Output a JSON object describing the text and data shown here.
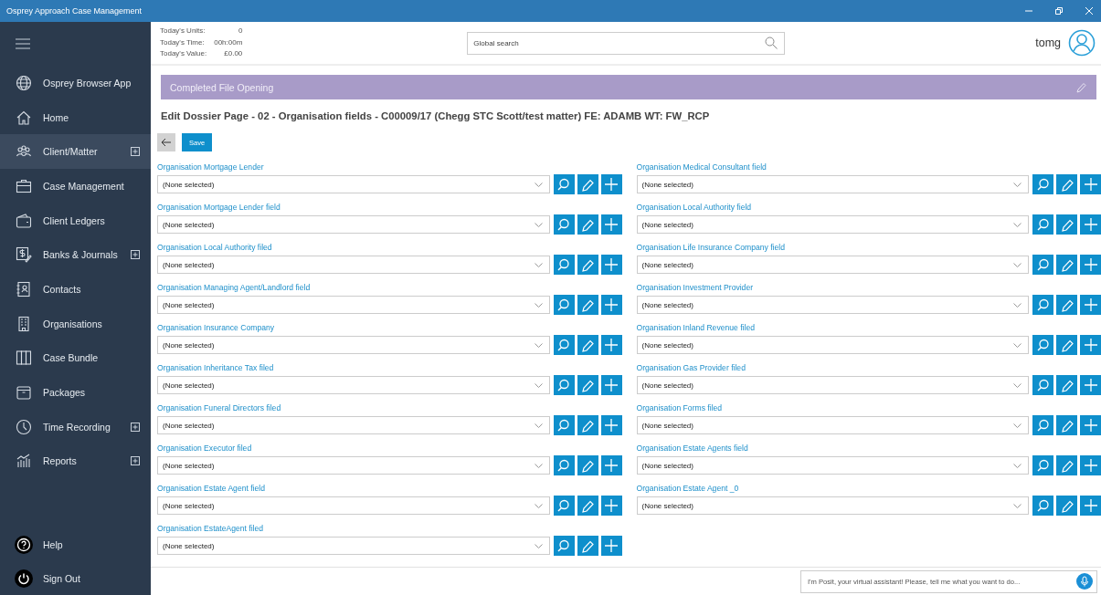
{
  "window": {
    "title": "Osprey Approach Case Management"
  },
  "sidebar": {
    "items": [
      {
        "label": "Osprey Browser App",
        "expandable": false,
        "selected": false
      },
      {
        "label": "Home",
        "expandable": false,
        "selected": false
      },
      {
        "label": "Client/Matter",
        "expandable": true,
        "selected": true
      },
      {
        "label": "Case Management",
        "expandable": false,
        "selected": false
      },
      {
        "label": "Client Ledgers",
        "expandable": false,
        "selected": false
      },
      {
        "label": "Banks & Journals",
        "expandable": true,
        "selected": false
      },
      {
        "label": "Contacts",
        "expandable": false,
        "selected": false
      },
      {
        "label": "Organisations",
        "expandable": false,
        "selected": false
      },
      {
        "label": "Case Bundle",
        "expandable": false,
        "selected": false
      },
      {
        "label": "Packages",
        "expandable": false,
        "selected": false
      },
      {
        "label": "Time Recording",
        "expandable": true,
        "selected": false
      },
      {
        "label": "Reports",
        "expandable": true,
        "selected": false
      }
    ],
    "footer_items": [
      {
        "label": "Help"
      },
      {
        "label": "Sign Out"
      }
    ]
  },
  "header": {
    "stats": [
      {
        "label": "Today's Units:",
        "value": "0"
      },
      {
        "label": "Today's Time:",
        "value": "00h:00m"
      },
      {
        "label": "Today's Value:",
        "value": "£0.00"
      }
    ],
    "search": {
      "placeholder": "Global search"
    },
    "user": "tomg"
  },
  "banner": {
    "title": "Completed File Opening"
  },
  "page_title": "Edit Dossier Page - 02 - Organisation fields - C00009/17 (Chegg STC Scott/test matter) FE: ADAMB WT: FW_RCP",
  "save_button": "Save",
  "fields": {
    "left": [
      {
        "label": "Organisation Mortgage Lender",
        "value": "(None selected)"
      },
      {
        "label": "Organisation Mortgage Lender field",
        "value": "(None selected)"
      },
      {
        "label": "Organisation Local Authority filed",
        "value": "(None selected)"
      },
      {
        "label": "Organisation Managing Agent/Landlord field",
        "value": "(None selected)"
      },
      {
        "label": "Organisation Insurance Company",
        "value": "(None selected)"
      },
      {
        "label": "Organisation Inheritance Tax filed",
        "value": "(None selected)"
      },
      {
        "label": "Organisation Funeral Directors filed",
        "value": "(None selected)"
      },
      {
        "label": "Organisation Executor filed",
        "value": "(None selected)"
      },
      {
        "label": "Organisation Estate Agent field",
        "value": "(None selected)"
      },
      {
        "label": "Organisation EstateAgent filed",
        "value": "(None selected)"
      }
    ],
    "right": [
      {
        "label": "Organisation Medical Consultant field",
        "value": "(None selected)"
      },
      {
        "label": "Organisation Local Authority field",
        "value": "(None selected)"
      },
      {
        "label": "Organisation Life Insurance Company field",
        "value": "(None selected)"
      },
      {
        "label": "Organisation Investment Provider",
        "value": "(None selected)"
      },
      {
        "label": "Organisation Inland Revenue filed",
        "value": "(None selected)"
      },
      {
        "label": "Organisation Gas Provider filed",
        "value": "(None selected)"
      },
      {
        "label": "Organisation Forms filed",
        "value": "(None selected)"
      },
      {
        "label": "Organisation Estate Agents field",
        "value": "(None selected)"
      },
      {
        "label": "Organisation Estate Agent _0",
        "value": "(None selected)"
      }
    ]
  },
  "assistant": {
    "placeholder": "I'm Posit, your virtual assistant! Please, tell me what you want to do..."
  }
}
